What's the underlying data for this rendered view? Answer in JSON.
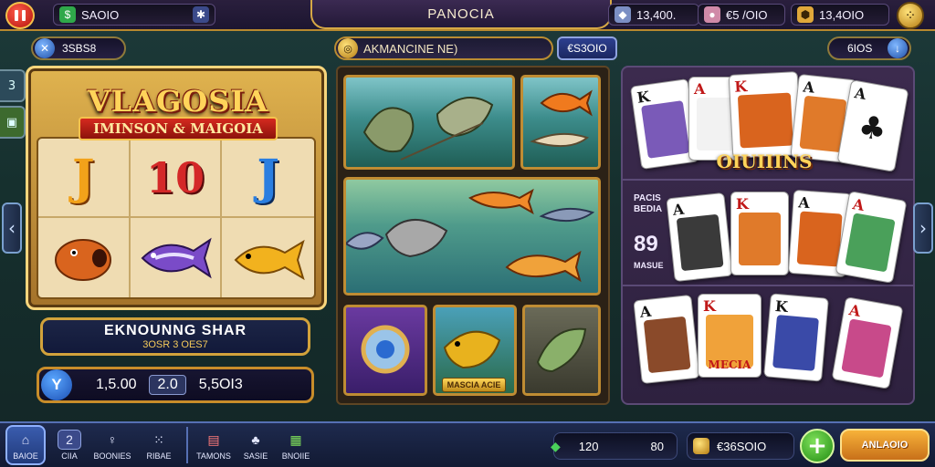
{
  "top_bar": {
    "left_balance": "SAOIO",
    "title": "PANOCIA",
    "stat1": "13,400.",
    "stat2": "€5 /OIO",
    "stat3": "13,4OIO"
  },
  "second_row": {
    "left_pill": "3SBS8",
    "mid_header": "AKMANCINE NE)",
    "mid_value": "€S3OIO",
    "right_pill": "6IOS"
  },
  "slot": {
    "title": "VLAGOSIA",
    "subtitle": "IMINSON & MAIGOIA",
    "symbols": [
      "J",
      "10",
      "J",
      "fish",
      "fish",
      "fish"
    ],
    "info_title": "EKNOUNNG SHAR",
    "info_sub": "3OSR 3 OES7",
    "bet_icon": "Y",
    "bet_value1": "1,5.00",
    "bet_value2": "2.0",
    "bet_value3": "5,5OI3"
  },
  "middle": {
    "tile_label": "MASCIA ACIE"
  },
  "cards": {
    "title": "OIUIIINS",
    "side_label1": "PACIS",
    "side_label2": "BEDIA",
    "side_number": "89",
    "side_label3": "MASUE",
    "row1": [
      "K",
      "A",
      "K",
      "A",
      "A"
    ],
    "row2": [
      "A",
      "K",
      "A",
      "A"
    ],
    "row3": [
      "A",
      "K",
      "K",
      "A"
    ],
    "mid_card_caption": "MECIA"
  },
  "bottom_bar": {
    "nav": [
      {
        "label": "BAIOE",
        "icon": "home-icon"
      },
      {
        "label": "CIIA",
        "icon": "2"
      },
      {
        "label": "BOONIES",
        "icon": "chip-icon"
      },
      {
        "label": "RIBAE",
        "icon": "grid-icon"
      },
      {
        "label": "TAMONS",
        "icon": "gift-icon"
      },
      {
        "label": "SASIE",
        "icon": "club-icon"
      },
      {
        "label": "BNOIIE",
        "icon": "calendar-icon"
      }
    ],
    "stat_a1": "120",
    "stat_a2": "80",
    "coins": "€36SOIO",
    "action_button": "ANLAOIO"
  },
  "colors": {
    "gold": "#d2a23b",
    "panel_purple": "#3c2b4e",
    "accent_green": "#218c12",
    "accent_red": "#b3140c"
  }
}
